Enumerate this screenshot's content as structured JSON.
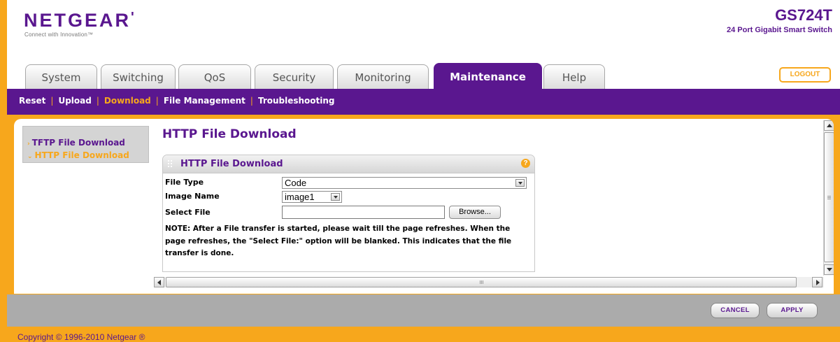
{
  "header": {
    "brand": "NETGEAR",
    "brand_mark": "'",
    "tagline": "Connect with Innovation™",
    "model": "GS724T",
    "model_desc": "24 Port Gigabit Smart Switch"
  },
  "tabs": [
    {
      "label": "System"
    },
    {
      "label": "Switching"
    },
    {
      "label": "QoS"
    },
    {
      "label": "Security"
    },
    {
      "label": "Monitoring"
    },
    {
      "label": "Maintenance",
      "active": true
    },
    {
      "label": "Help"
    }
  ],
  "logout_label": "LOGOUT",
  "subnav": {
    "items": [
      "Reset",
      "Upload",
      "Download",
      "File Management",
      "Troubleshooting"
    ],
    "active": "Download",
    "separator": "|"
  },
  "leftnav": {
    "items": [
      {
        "label": "TFTP File Download",
        "marker": "›"
      },
      {
        "label": "HTTP File Download",
        "marker": "⌄",
        "active": true
      }
    ]
  },
  "page_title": "HTTP File Download",
  "section": {
    "title": "HTTP File Download",
    "help_glyph": "?",
    "fields": {
      "file_type": {
        "label": "File Type",
        "value": "Code"
      },
      "image_name": {
        "label": "Image Name",
        "value": "image1"
      },
      "select_file": {
        "label": "Select File",
        "value": "",
        "browse_label": "Browse..."
      }
    },
    "note": "NOTE: After a File transfer is started, please wait till the page refreshes. When the page refreshes, the \"Select File:\" option will be blanked. This indicates that the file transfer is done."
  },
  "buttons": {
    "cancel": "CANCEL",
    "apply": "APPLY"
  },
  "copyright": "Copyright © 1996-2010 Netgear ®",
  "colors": {
    "brand_purple": "#5a178f",
    "accent_orange": "#f7a71c",
    "footer_gray": "#ababab"
  }
}
